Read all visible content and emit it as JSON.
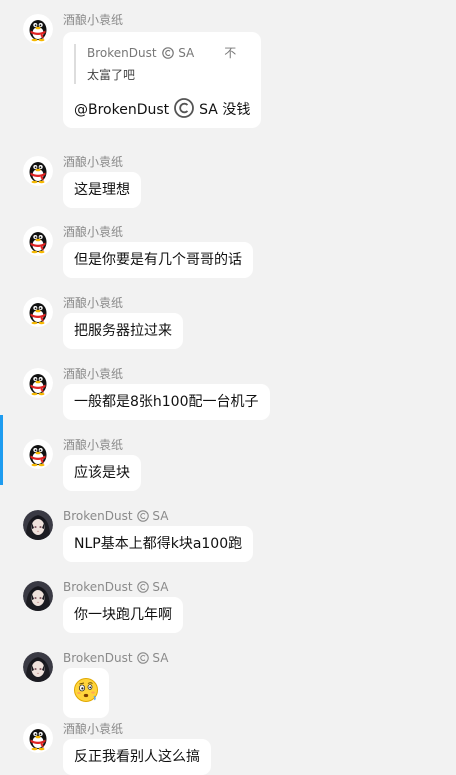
{
  "messages": [
    {
      "sender": "酒酿小袁纸",
      "avatar": "qq-penguin-avatar",
      "quote": {
        "author": "BrokenDust",
        "author_suffix": "SA",
        "tail": "不",
        "text": "太富了吧"
      },
      "mention": "@BrokenDust",
      "mention_suffix": "SA",
      "text": "没钱"
    },
    {
      "sender": "酒酿小袁纸",
      "avatar": "qq-penguin-avatar",
      "text": "这是理想"
    },
    {
      "sender": "酒酿小袁纸",
      "avatar": "qq-penguin-avatar",
      "text": "但是你要是有几个哥哥的话"
    },
    {
      "sender": "酒酿小袁纸",
      "avatar": "qq-penguin-avatar",
      "text": "把服务器拉过来"
    },
    {
      "sender": "酒酿小袁纸",
      "avatar": "qq-penguin-avatar",
      "text": "一般都是8张h100配一台机子"
    },
    {
      "sender": "酒酿小袁纸",
      "avatar": "qq-penguin-avatar",
      "text": "应该是块"
    },
    {
      "sender": "BrokenDust",
      "sender_suffix": "SA",
      "avatar": "anime-girl-avatar",
      "text": "NLP基本上都得k块a100跑"
    },
    {
      "sender": "BrokenDust",
      "sender_suffix": "SA",
      "avatar": "anime-girl-avatar",
      "text": "你一块跑几年啊"
    },
    {
      "sender": "BrokenDust",
      "sender_suffix": "SA",
      "avatar": "anime-girl-avatar",
      "emoji": "confused-face-emoji"
    },
    {
      "sender": "酒酿小袁纸",
      "avatar": "qq-penguin-avatar",
      "text": "反正我看别人这么搞"
    }
  ],
  "colors": {
    "background": "#f2f2f2",
    "bubble": "#ffffff",
    "sender_text": "#8a8a8a",
    "scroll_marker": "#1e9cf0"
  }
}
